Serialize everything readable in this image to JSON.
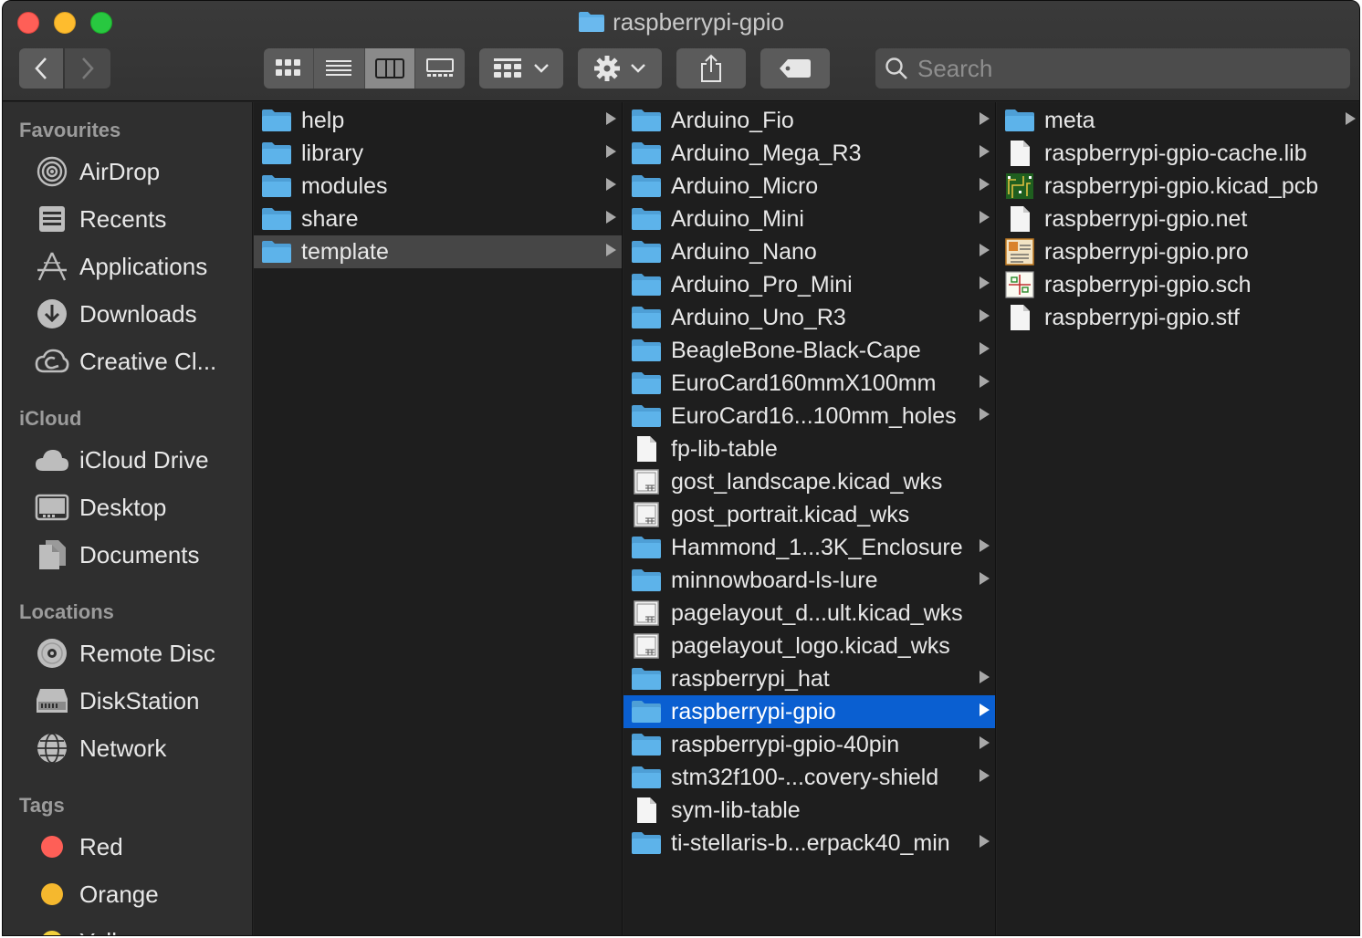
{
  "window": {
    "title": "raspberrypi-gpio"
  },
  "toolbar": {
    "back": "back",
    "forward": "forward",
    "view_modes": [
      "icon-view",
      "list-view",
      "column-view",
      "gallery-view"
    ],
    "group_button": "group-by",
    "action_button": "action-gear",
    "share_button": "share",
    "tag_button": "edit-tags",
    "search_placeholder": "Search"
  },
  "sidebar": {
    "sections": [
      {
        "heading": "Favourites",
        "items": [
          {
            "label": "AirDrop",
            "icon": "airdrop-icon"
          },
          {
            "label": "Recents",
            "icon": "recents-icon"
          },
          {
            "label": "Applications",
            "icon": "applications-icon"
          },
          {
            "label": "Downloads",
            "icon": "downloads-icon"
          },
          {
            "label": "Creative Cl...",
            "icon": "creative-cloud-icon"
          }
        ]
      },
      {
        "heading": "iCloud",
        "items": [
          {
            "label": "iCloud Drive",
            "icon": "icloud-icon"
          },
          {
            "label": "Desktop",
            "icon": "desktop-icon"
          },
          {
            "label": "Documents",
            "icon": "documents-icon"
          }
        ]
      },
      {
        "heading": "Locations",
        "items": [
          {
            "label": "Remote Disc",
            "icon": "remote-disc-icon"
          },
          {
            "label": "DiskStation",
            "icon": "diskstation-icon"
          },
          {
            "label": "Network",
            "icon": "network-icon"
          }
        ]
      },
      {
        "heading": "Tags",
        "items": [
          {
            "label": "Red",
            "icon": "tag-red-icon",
            "color": "#fe5f57"
          },
          {
            "label": "Orange",
            "icon": "tag-orange-icon",
            "color": "#f5b82e"
          },
          {
            "label": "Yellow",
            "icon": "tag-yellow-icon",
            "color": "#f2d13b"
          }
        ]
      }
    ]
  },
  "columns": [
    {
      "items": [
        {
          "name": "help",
          "type": "folder",
          "has_children": true
        },
        {
          "name": "library",
          "type": "folder",
          "has_children": true
        },
        {
          "name": "modules",
          "type": "folder",
          "has_children": true
        },
        {
          "name": "share",
          "type": "folder",
          "has_children": true
        },
        {
          "name": "template",
          "type": "folder",
          "has_children": true,
          "selected": "inactive"
        }
      ]
    },
    {
      "items": [
        {
          "name": "Arduino_Fio",
          "type": "folder",
          "has_children": true
        },
        {
          "name": "Arduino_Mega_R3",
          "type": "folder",
          "has_children": true
        },
        {
          "name": "Arduino_Micro",
          "type": "folder",
          "has_children": true
        },
        {
          "name": "Arduino_Mini",
          "type": "folder",
          "has_children": true
        },
        {
          "name": "Arduino_Nano",
          "type": "folder",
          "has_children": true
        },
        {
          "name": "Arduino_Pro_Mini",
          "type": "folder",
          "has_children": true
        },
        {
          "name": "Arduino_Uno_R3",
          "type": "folder",
          "has_children": true
        },
        {
          "name": "BeagleBone-Black-Cape",
          "type": "folder",
          "has_children": true
        },
        {
          "name": "EuroCard160mmX100mm",
          "type": "folder",
          "has_children": true
        },
        {
          "name": "EuroCard16...100mm_holes",
          "type": "folder",
          "has_children": true
        },
        {
          "name": "fp-lib-table",
          "type": "file",
          "has_children": false
        },
        {
          "name": "gost_landscape.kicad_wks",
          "type": "wks",
          "has_children": false
        },
        {
          "name": "gost_portrait.kicad_wks",
          "type": "wks",
          "has_children": false
        },
        {
          "name": "Hammond_1...3K_Enclosure",
          "type": "folder",
          "has_children": true
        },
        {
          "name": "minnowboard-ls-lure",
          "type": "folder",
          "has_children": true
        },
        {
          "name": "pagelayout_d...ult.kicad_wks",
          "type": "wks",
          "has_children": false
        },
        {
          "name": "pagelayout_logo.kicad_wks",
          "type": "wks",
          "has_children": false
        },
        {
          "name": "raspberrypi_hat",
          "type": "folder",
          "has_children": true
        },
        {
          "name": "raspberrypi-gpio",
          "type": "folder",
          "has_children": true,
          "selected": "active"
        },
        {
          "name": "raspberrypi-gpio-40pin",
          "type": "folder",
          "has_children": true
        },
        {
          "name": "stm32f100-...covery-shield",
          "type": "folder",
          "has_children": true
        },
        {
          "name": "sym-lib-table",
          "type": "file",
          "has_children": false
        },
        {
          "name": "ti-stellaris-b...erpack40_min",
          "type": "folder",
          "has_children": true
        }
      ]
    },
    {
      "items": [
        {
          "name": "meta",
          "type": "folder",
          "has_children": true
        },
        {
          "name": "raspberrypi-gpio-cache.lib",
          "type": "file",
          "has_children": false
        },
        {
          "name": "raspberrypi-gpio.kicad_pcb",
          "type": "pcb",
          "has_children": false
        },
        {
          "name": "raspberrypi-gpio.net",
          "type": "file",
          "has_children": false
        },
        {
          "name": "raspberrypi-gpio.pro",
          "type": "pro",
          "has_children": false
        },
        {
          "name": "raspberrypi-gpio.sch",
          "type": "sch",
          "has_children": false
        },
        {
          "name": "raspberrypi-gpio.stf",
          "type": "file",
          "has_children": false
        }
      ]
    }
  ],
  "colors": {
    "folder": "#5aaee6",
    "selection_active": "#0a5fd1",
    "selection_inactive": "#464646"
  }
}
